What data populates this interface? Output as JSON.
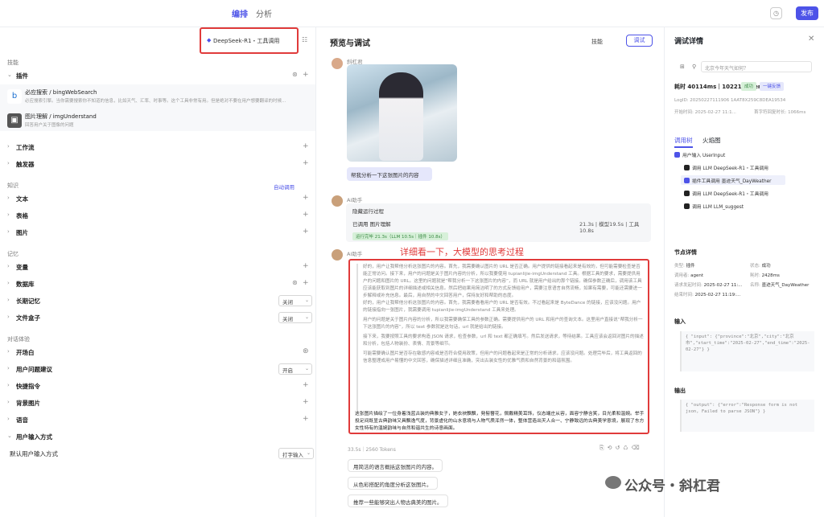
{
  "topbar": {
    "tab_arrange": "编排",
    "tab_analyze": "分析",
    "publish": "发布"
  },
  "left": {
    "model_name": "DeepSeek-R1・工具调用",
    "section_skills": "技能",
    "plugin_label": "插件",
    "plugins": [
      {
        "name": "必应搜索 / bingWebSearch",
        "desc": "必应搜索引擎。当你需要搜索你不知道的信息，比如天气、汇率、时事等。这个工具非常有用。但是绝对不要在用户想要翻译的时候..."
      },
      {
        "name": "图片理解 / imgUnderstand",
        "desc": "回答用户关于图像的问题"
      }
    ],
    "workflow": "工作流",
    "trigger": "触发器",
    "section_knowledge": "知识",
    "auto_call": "自动调用",
    "text": "文本",
    "table": "表格",
    "image": "图片",
    "section_memory": "记忆",
    "variable": "变量",
    "database": "数据库",
    "long_memory": "长期记忆",
    "long_memory_value": "关闭",
    "file_box": "文件盒子",
    "file_box_value": "关闭",
    "section_dialog": "对话体验",
    "opening": "开场白",
    "user_suggest": "用户问题建议",
    "user_suggest_value": "开启",
    "shortcut": "快捷指令",
    "bg_image": "背景图片",
    "voice": "语音",
    "input_mode_section": "用户输入方式",
    "default_input_mode": "默认用户输入方式",
    "default_input_mode_value": "打字输入"
  },
  "mid": {
    "title": "预览与调试",
    "skill_btn": "技能",
    "debug_btn": "调试",
    "user_sender": "斜杠君",
    "user_msg": "帮我分析一下这张图片的内容",
    "bot_sender": "AI助手",
    "hide_process": "隐藏运行过程",
    "called": "已调用 图片理解",
    "called_time": "21.3s | 模型19.5s | 工具10.8s",
    "run_done": "运行完毕 21.3s（LLM 10.5s｜插件 10.8s）",
    "annotation": "详细看一下，大模型的思考过程",
    "think_p1": "好的，用户让我帮他分析这张图片的内容。首先，我需要确认图片的 URL 是否正确。用户提供的链接看起来是有效的，但可能需要检查是否能正常访问。接下来，用户的问题是关于图片内容的分析，所以我要使用 tupianlijie-imgUnderstand 工具。根据工具的要求，需要提供用户的问题和图片的 URL。这里的问题就是“帮我分析一下这张图片的内容”，而 URL 就是用户给出的那个链接。确保参数正确后，调用该工具应该能获取到图片的详细描述或相关信息。然后把结果用简洁明了的方式反馈给用户，需要注意语言自然流畅，如果有需要，可能还需要进一步解释或补充信息。最后，用自然的中文回答用户，保持友好和帮助的态度。",
    "think_p2": "好的，用户让我帮他分析这张图片的内容。首先，我需要看看用户的 URL 是否有效。不过看起来是 ByteDance 的链接，应该没问题。用户的链接指向一张图片，我需要调用 tupianlijie-imgUnderstand 工具来处理。",
    "think_p3": "用户的问题是关于图片内容的分析，所以我需要确保工具的参数正确。需要提供用户的 URL 和用户的查询文本。这里用户直接说“帮我分析一下这张图片的内容”，所以 text 参数就是这句话，url 就是给出的链接。",
    "think_p4": "接下来，我要按照工具的要求构造 JSON 请求，检查参数，url 和 text 都正确填写。然后发送请求，等待结果。工具应该会返回对图片的描述和分析，包括人物装扮、表情、背景等细节。",
    "think_p5": "可能需要确认图片是否存在敏感内容或是否符合使用政策，但用户的问题看起来是正常的分析请求，应该没问题。处理完毕后，将工具返回的信息整理成用户易懂的中文回答，确保描述详细且准确，突出古装女性的优雅气质和自然背景的和谐氛围。",
    "final_answer": "这张图片描绘了一位身着浅蓝古装的典雅女子，她衣袂飘飘，発髻簪花，佩戴精美耳饰，仪态端庄从容，面容宁静含笑，目光柔和温婉。举手投足间既显古典韵味又具飘逸气度，背景虚化的山水意境与人物气质浑然一体，整体营造出天人合一、宁静致远的古典美学意境，展现了东方女性特有的温婉韵味与自然和谐共生的诗意画面。",
    "stat": "33.5s｜2560 Tokens",
    "suggestions": [
      "用简洁的语言概括这张图片的内容。",
      "从色彩搭配的角度分析这张图片。",
      "推荐一些能够突出人物古典美的图片。"
    ]
  },
  "right": {
    "title": "调试详情",
    "search_placeholder": "北京今年天气如何？",
    "summary": "耗时 40114ms｜10221 Tokens",
    "status_ok": "成功",
    "mark": "一键反馈",
    "logid": "LogID: 20250227111906 1AAT8X259C8DEA19534",
    "start": "开始时间: 2025-02-27 11:1...",
    "first_token": "首字符回复时长: 1066ms",
    "tab_tree": "调用树",
    "tab_flame": "火焰图",
    "tree": [
      "用户输入 UserInput",
      "调用 LLM DeepSeek-R1・工具调用",
      "插件工具调用 墨迹天气_DayWeather",
      "调用 LLM DeepSeek-R1・工具调用",
      "调用 LLM LLM_suggest"
    ],
    "node_detail": "节点详情",
    "type_k": "类型:",
    "type_v": "插件",
    "status_k": "状态:",
    "status_v": "成功",
    "caller_k": "调用者:",
    "caller_v": "agent",
    "dur_k": "耗时:",
    "dur_v": "2428ms",
    "req_k": "请求发起时间:",
    "req_v": "2025-02-27 11:...",
    "name_k": "名称:",
    "name_v": "墨迹天气_DayWeather",
    "end_k": "结束时间:",
    "end_v": "2025-02-27 11:19:...",
    "input_h": "输入",
    "input_code": "{ \"input\": {\"province\":\"北京\",\"city\":\"北京市\",\"start_time\":\"2025-02-27\",\"end_time\":\"2025-02-27\"} }",
    "output_h": "输出",
    "output_code": "{ \"output\": {\"error\":\"Response form is not json, Failed to parse JSON\"} }"
  },
  "watermark": "公众号・斜杠君"
}
